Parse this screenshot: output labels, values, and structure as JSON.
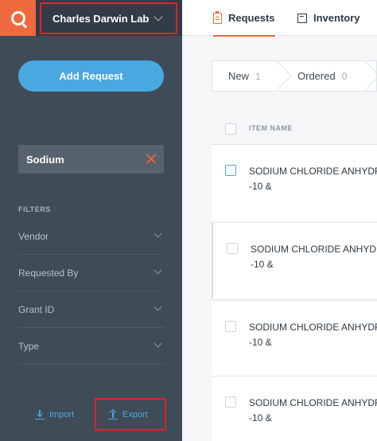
{
  "sidebar": {
    "lab_name": "Charles Darwin Lab",
    "add_request_label": "Add Request",
    "search_term": "Sodium",
    "filters_title": "FILTERS",
    "filters": [
      {
        "label": "Vendor"
      },
      {
        "label": "Requested By"
      },
      {
        "label": "Grant ID"
      },
      {
        "label": "Type"
      }
    ],
    "import_label": "Import",
    "export_label": "Export"
  },
  "header": {
    "tabs": [
      {
        "label": "Requests",
        "active": true,
        "icon": "clipboard-icon"
      },
      {
        "label": "Inventory",
        "active": false,
        "icon": "box-icon"
      }
    ]
  },
  "status_tabs": [
    {
      "label": "New",
      "count": "1"
    },
    {
      "label": "Ordered",
      "count": "0"
    }
  ],
  "table": {
    "column_header": "ITEM NAME",
    "rows": [
      {
        "line1": "SODIUM CHLORIDE ANHYDROUS",
        "line2": "-10 &"
      },
      {
        "line1": "SODIUM CHLORIDE ANHYDROUS",
        "line2": "-10 &"
      },
      {
        "line1": "SODIUM CHLORIDE ANHYDROUS",
        "line2": "-10 &"
      },
      {
        "line1": "SODIUM CHLORIDE ANHYDROUS",
        "line2": "-10 &"
      }
    ]
  },
  "colors": {
    "accent": "#ef6a3f",
    "primary_blue": "#4aa8e0",
    "sidebar_bg": "#3f4b57",
    "highlight_box": "#d6262d"
  }
}
